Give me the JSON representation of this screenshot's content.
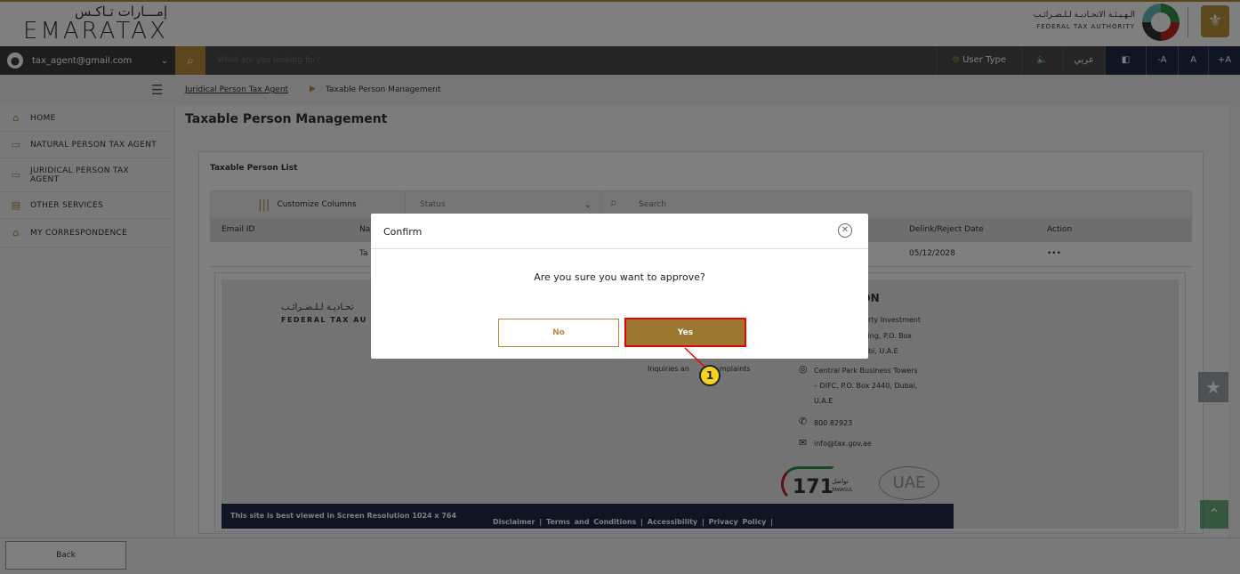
{
  "header": {
    "brand_ar": "إمـــارات تـاكـس",
    "brand_en": "EMARATAX",
    "fta_ar": "الـهـيـئـة الاتحـاديـة لـلـضـرائـب",
    "fta_en": "FEDERAL TAX AUTHORITY"
  },
  "nav": {
    "user_email": "tax_agent@gmail.com",
    "search_placeholder": "What are you looking for?",
    "user_type": "User Type",
    "lang": "عربي",
    "font_minus": "-A",
    "font_normal": "A",
    "font_plus": "+A"
  },
  "breadcrumb": {
    "parent": "Juridical Person Tax Agent",
    "current": "Taxable Person Management"
  },
  "sidebar": {
    "items": [
      {
        "label": "HOME",
        "icon": "home-icon"
      },
      {
        "label": "NATURAL PERSON TAX AGENT",
        "icon": "id-card-icon"
      },
      {
        "label": "JURIDICAL PERSON TAX AGENT",
        "icon": "id-card-icon"
      },
      {
        "label": "OTHER SERVICES",
        "icon": "document-icon"
      },
      {
        "label": "MY CORRESPONDENCE",
        "icon": "building-icon"
      }
    ]
  },
  "main": {
    "title": "Taxable Person Management",
    "list_title": "Taxable Person List",
    "customize_columns": "Customize Columns",
    "status_placeholder": "Status",
    "search_placeholder": "Search",
    "columns": [
      "Email ID",
      "Na",
      "Delink/Reject Date",
      "Action"
    ],
    "row": {
      "name": "Ta",
      "date": "05/12/2028",
      "action": "•••"
    }
  },
  "footer": {
    "fta_ar": "تحـاديـة لـلـضـرائـب",
    "fta_en": "FEDERAL TAX AU",
    "location_title": "ION",
    "addr1_l1": "perty Investment",
    "addr1_l2": "ilding, P.O. Box",
    "addr1_l3": "habi, U.A.E",
    "inquiries": "Inquiries an",
    "inquiries_end": "mplaints",
    "addr2_l1": "Central Park Business Towers",
    "addr2_l2": "– DIFC, P.O. Box 2440, Dubai,",
    "addr2_l3": "U.A.E",
    "phone": "800 82923",
    "email": "info@tax.gov.ae",
    "tawasul": "171",
    "tawasul_ar": "تواصل",
    "tawasul_en": "TAWASUL",
    "uae": "UAE",
    "best_viewed": "This site is best viewed in Screen Resolution 1024 x 764",
    "links": "Disclaimer  |  Terms and Conditions  |  Accessibility  |  Privacy Policy  |"
  },
  "bottom": {
    "back": "Back"
  },
  "modal": {
    "title": "Confirm",
    "message": "Are you sure you want to approve?",
    "no": "No",
    "yes": "Yes",
    "callout": "1"
  },
  "colors": {
    "accent": "#b48a3d",
    "nav": "#4a4a4a",
    "highlight": "#e00000"
  }
}
